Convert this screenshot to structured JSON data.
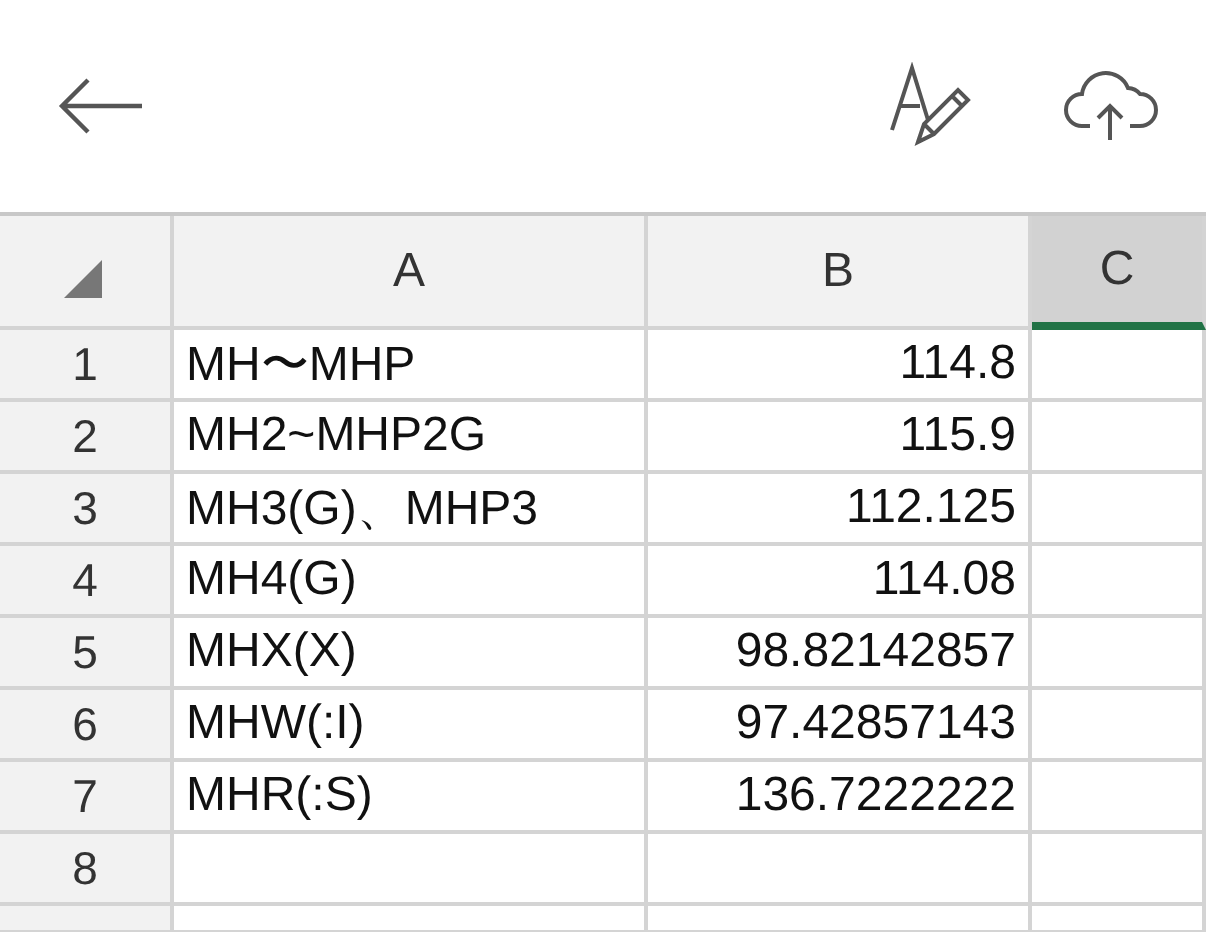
{
  "columns": [
    {
      "label": "A",
      "selected": false
    },
    {
      "label": "B",
      "selected": false
    },
    {
      "label": "C",
      "selected": true
    }
  ],
  "rows": [
    {
      "number": "1",
      "cells": [
        "MH〜MHP",
        "114.8"
      ]
    },
    {
      "number": "2",
      "cells": [
        "MH2~MHP2G",
        "115.9"
      ]
    },
    {
      "number": "3",
      "cells": [
        "MH3(G)、MHP3",
        "112.125"
      ]
    },
    {
      "number": "4",
      "cells": [
        "MH4(G)",
        "114.08"
      ]
    },
    {
      "number": "5",
      "cells": [
        "MHX(X)",
        "98.82142857"
      ]
    },
    {
      "number": "6",
      "cells": [
        "MHW(:I)",
        "97.42857143"
      ]
    },
    {
      "number": "7",
      "cells": [
        "MHR(:S)",
        "136.7222222"
      ]
    },
    {
      "number": "8",
      "cells": []
    }
  ]
}
